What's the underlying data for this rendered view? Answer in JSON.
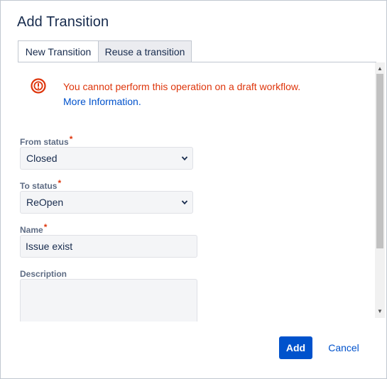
{
  "dialog": {
    "title": "Add Transition"
  },
  "tabs": [
    {
      "label": "New Transition",
      "active": true
    },
    {
      "label": "Reuse a transition",
      "active": false
    }
  ],
  "error": {
    "icon": "error-circle-icon",
    "message": "You cannot perform this operation on a draft workflow.",
    "link_text": "More Information."
  },
  "form": {
    "from_status": {
      "label": "From status",
      "required_mark": "*",
      "value": "Closed"
    },
    "to_status": {
      "label": "To status",
      "required_mark": "*",
      "value": "ReOpen"
    },
    "name": {
      "label": "Name",
      "required_mark": "*",
      "value": "Issue exist"
    },
    "description": {
      "label": "Description",
      "value": ""
    }
  },
  "footer": {
    "add_label": "Add",
    "cancel_label": "Cancel"
  },
  "colors": {
    "primary": "#0052cc",
    "error": "#de350b",
    "title": "#172b4d",
    "label": "#5e6c84",
    "field_bg": "#f4f5f7"
  }
}
